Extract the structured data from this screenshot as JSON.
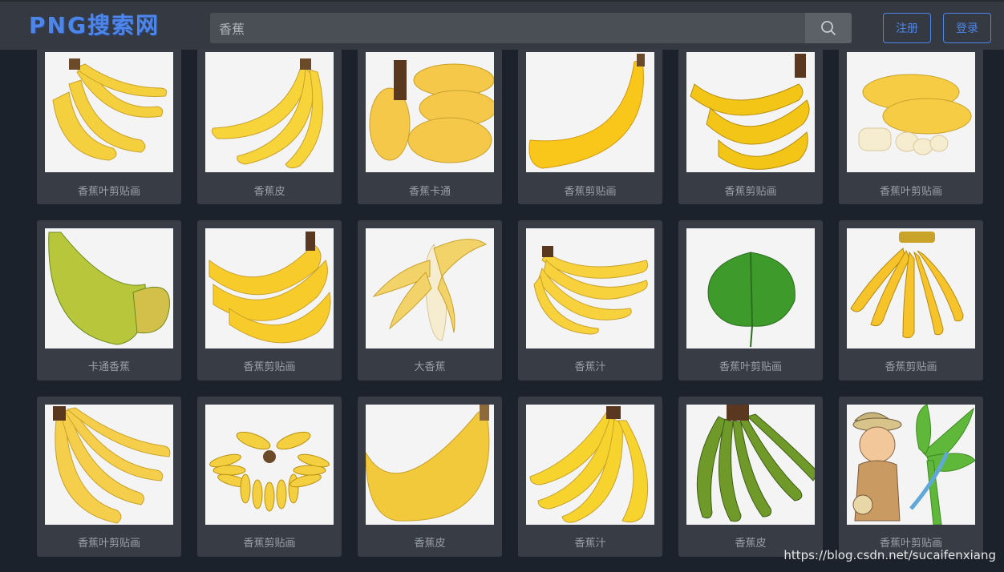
{
  "header": {
    "logo": "PNG搜索网",
    "search_value": "香蕉",
    "register_label": "注册",
    "login_label": "登录"
  },
  "rows": [
    [
      "香蕉叶剪贴画",
      "香蕉皮",
      "香蕉卡通",
      "香蕉剪贴画",
      "香蕉剪贴画",
      "香蕉叶剪贴画"
    ],
    [
      "卡通香蕉",
      "香蕉剪贴画",
      "大香蕉",
      "香蕉汁",
      "香蕉叶剪贴画",
      "香蕉剪贴画"
    ],
    [
      "香蕉叶剪贴画",
      "香蕉剪贴画",
      "香蕉皮",
      "香蕉汁",
      "香蕉皮",
      "香蕉叶剪贴画"
    ]
  ],
  "watermark": "https://blog.csdn.net/sucaifenxiang"
}
